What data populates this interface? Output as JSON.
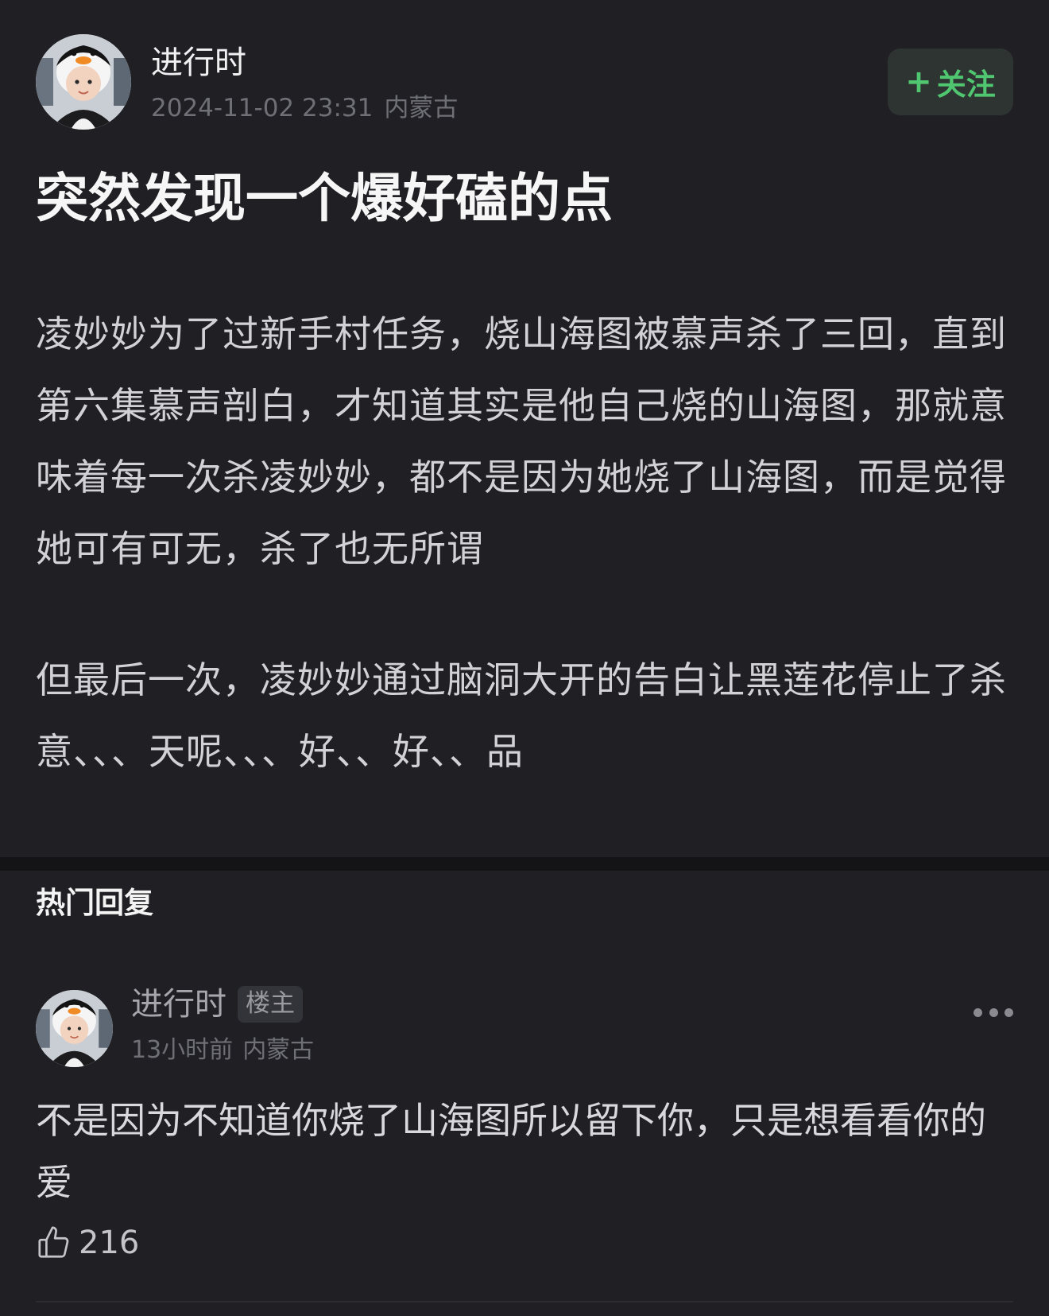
{
  "post": {
    "author_name": "进行时",
    "timestamp": "2024-11-02 23:31",
    "location": "内蒙古",
    "follow_plus": "+",
    "follow_label": "关注",
    "title": "突然发现一个爆好磕的点",
    "paragraphs": [
      "凌妙妙为了过新手村任务，烧山海图被慕声杀了三回，直到第六集慕声剖白，才知道其实是他自己烧的山海图，那就意味着每一次杀凌妙妙，都不是因为她烧了山海图，而是觉得她可有可无，杀了也无所谓",
      "但最后一次，凌妙妙通过脑洞大开的告白让黑莲花停止了杀意、、、天呢、、、好、、好、、品"
    ]
  },
  "hot_replies": {
    "section_title": "热门回复",
    "items": [
      {
        "author_name": "进行时",
        "badge": "楼主",
        "time": "13小时前",
        "location": "内蒙古",
        "content": "不是因为不知道你烧了山海图所以留下你，只是想看看你的爱",
        "likes": "216"
      }
    ]
  },
  "colors": {
    "background": "#202024",
    "accent_green": "#4fc66f",
    "follow_bg": "#2e3432",
    "meta_gray": "#6f6f76"
  },
  "icons": {
    "more": "more-dots-icon",
    "like": "thumbs-up-icon"
  }
}
